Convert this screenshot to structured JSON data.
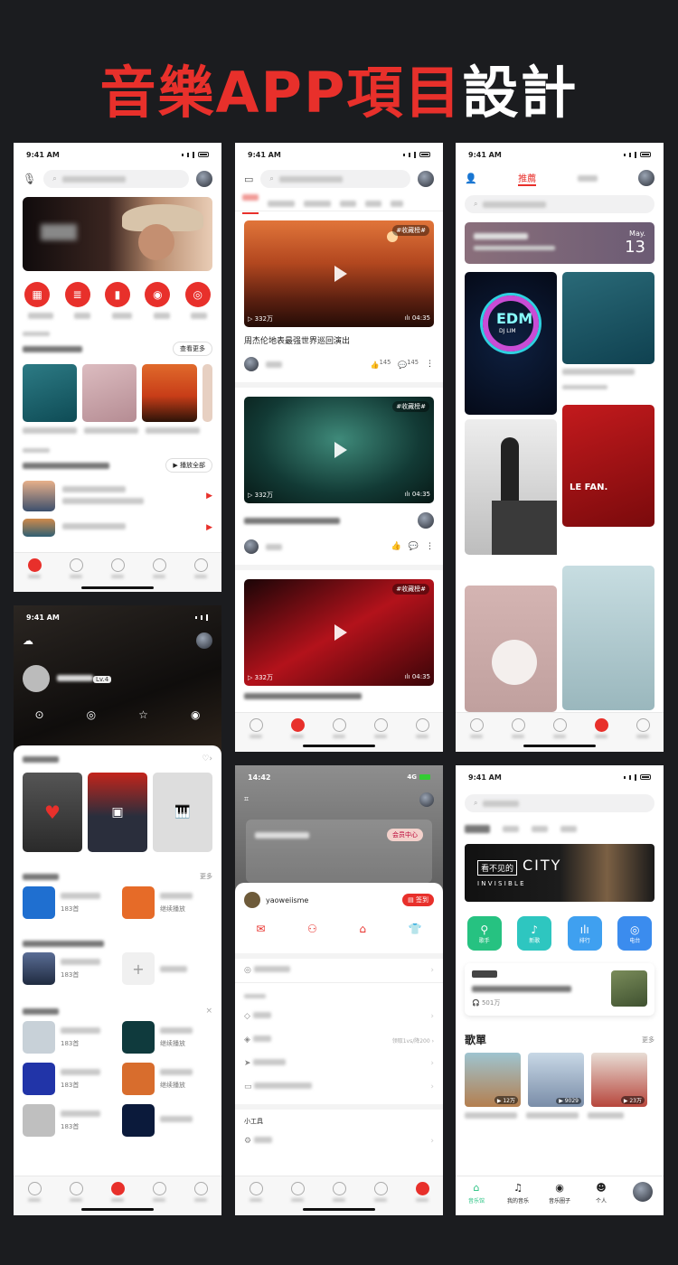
{
  "heading": {
    "red": "音樂APP項目",
    "white": "設計"
  },
  "status": {
    "time": "9:41 AM",
    "time2": "14:42",
    "net": "4G"
  },
  "p1": {
    "recommend_more": "查看更多",
    "play_all": "▶ 播放全部"
  },
  "p3": {
    "tab_recommend": "推薦",
    "card_month": "May.",
    "card_day": "13",
    "edm_title": "EDM",
    "edm_sub": "DJ LIM",
    "lefan": "LE FAN."
  },
  "p2": {
    "v1": {
      "tag": "#收藏榜#",
      "views": "332万",
      "duration": "04:35",
      "title": "周杰伦地表最强世界巡回演出",
      "likes": "145",
      "comments": "145"
    },
    "v2": {
      "tag": "#收藏榜#",
      "views": "332万",
      "duration": "04:35"
    },
    "v3": {
      "tag": "#收藏榜#",
      "views": "332万",
      "duration": "04:35"
    }
  },
  "p4": {
    "level": "Lv.4",
    "list": [
      {
        "count": "183首",
        "sub": "继续播放"
      },
      {
        "count": "183首"
      },
      {
        "count": "183首",
        "sub": "继续播放"
      },
      {
        "count": "183首",
        "sub": "继续播放"
      },
      {
        "count": "183首"
      }
    ],
    "more": "更多"
  },
  "p5": {
    "vip": "会员中心",
    "username": "yaoweiisme",
    "signin": "签到",
    "tools": "小工具",
    "coupon": "领取1vs/降200"
  },
  "p6": {
    "banner_city": "CITY",
    "banner_see": "看不见的",
    "banner_invis": "I N V I S I B L E",
    "icons": [
      "歌手",
      "新歌",
      "排行",
      "电台"
    ],
    "plays": "501万",
    "song_title": "歌單",
    "more": "更多",
    "counts": [
      "12万",
      "9029",
      "23万"
    ],
    "tabs": [
      "音乐馆",
      "我的音乐",
      "音乐圈子",
      "个人"
    ]
  }
}
